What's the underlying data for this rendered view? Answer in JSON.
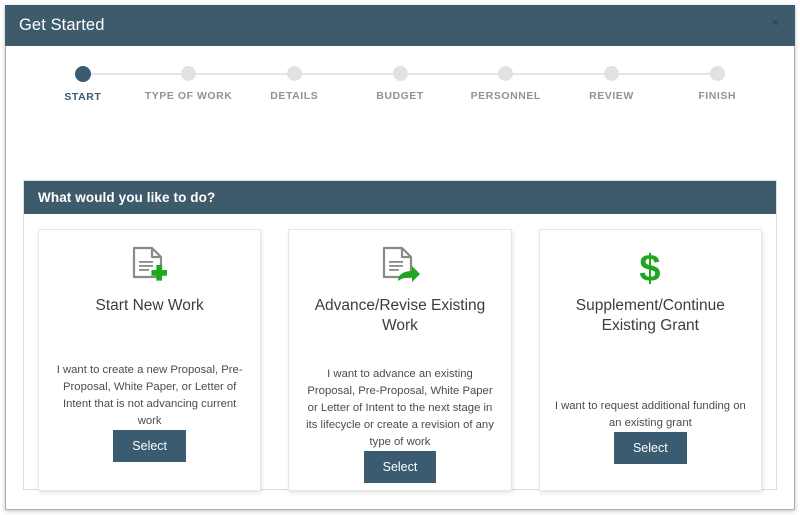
{
  "window": {
    "title": "Get Started",
    "close_label": "×"
  },
  "stepper": {
    "steps": [
      {
        "label": "START",
        "state": "active"
      },
      {
        "label": "TYPE OF WORK",
        "state": "inactive"
      },
      {
        "label": "DETAILS",
        "state": "inactive"
      },
      {
        "label": "BUDGET",
        "state": "inactive"
      },
      {
        "label": "PERSONNEL",
        "state": "inactive"
      },
      {
        "label": "REVIEW",
        "state": "inactive"
      },
      {
        "label": "FINISH",
        "state": "inactive"
      }
    ]
  },
  "panel": {
    "header": "What would you like to do?",
    "cards": [
      {
        "icon": "document-plus-icon",
        "title": "Start New Work",
        "description": "I want to create a new Proposal, Pre-Proposal, White Paper, or Letter of Intent that is not advancing current work",
        "button": "Select"
      },
      {
        "icon": "document-arrow-icon",
        "title": "Advance/Revise Existing Work",
        "description": "I want to advance an existing Proposal, Pre-Proposal, White Paper or Letter of Intent to the next stage in its lifecycle or create a revision of any type of work",
        "button": "Select"
      },
      {
        "icon": "dollar-sign-icon",
        "title": "Supplement/Continue Existing Grant",
        "description": "I want to request additional funding on an existing grant",
        "button": "Select"
      }
    ]
  },
  "colors": {
    "teal": "#3e5b6c",
    "button": "#3b5b70",
    "green": "#1fa81f",
    "icon_gray": "#8a8a8a",
    "step_inactive": "#e0e2e4",
    "step_label": "#8e9399"
  }
}
